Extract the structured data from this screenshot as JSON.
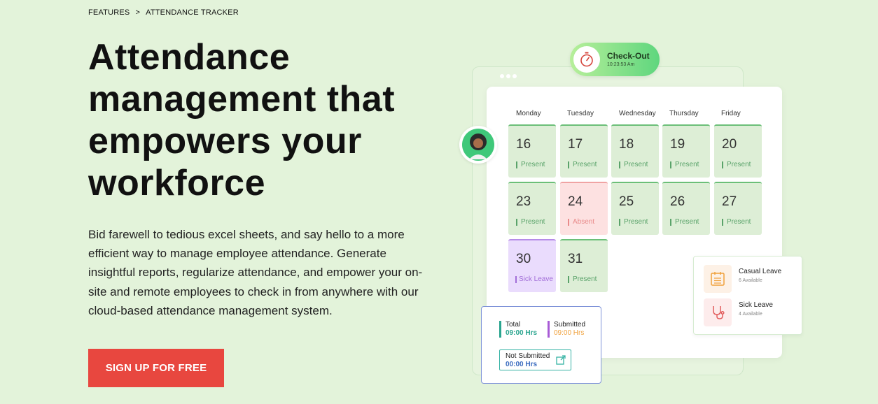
{
  "breadcrumb": {
    "items": [
      "FEATURES",
      "ATTENDANCE TRACKER"
    ],
    "separator": ">"
  },
  "hero": {
    "title_lines": [
      "Attendance",
      "management that",
      "empowers your",
      "workforce"
    ],
    "description": "Bid farewell to tedious excel sheets, and say hello to a more efficient way to manage employee attendance. Generate insightful reports, regularize attendance, and empower your on-site and remote employees to check in from anywhere with our cloud-based attendance management system.",
    "cta_label": "SIGN UP FOR FREE"
  },
  "checkout": {
    "label": "Check-Out",
    "time": "10:23:53 Am",
    "icon": "stopwatch-icon"
  },
  "calendar": {
    "days": [
      "Monday",
      "Tuesday",
      "Wednesday",
      "Thursday",
      "Friday"
    ],
    "weeks": [
      [
        {
          "date": "16",
          "status": "Present"
        },
        {
          "date": "17",
          "status": "Present"
        },
        {
          "date": "18",
          "status": "Present"
        },
        {
          "date": "19",
          "status": "Present"
        },
        {
          "date": "20",
          "status": "Present"
        }
      ],
      [
        {
          "date": "23",
          "status": "Present"
        },
        {
          "date": "24",
          "status": "Absent"
        },
        {
          "date": "25",
          "status": "Present"
        },
        {
          "date": "26",
          "status": "Present"
        },
        {
          "date": "27",
          "status": "Present"
        }
      ],
      [
        {
          "date": "30",
          "status": "Sick Leave"
        },
        {
          "date": "31",
          "status": "Present"
        }
      ]
    ]
  },
  "leave_balance": [
    {
      "type": "Casual Leave",
      "available": "6 Available",
      "icon": "calendar-list-icon"
    },
    {
      "type": "Sick Leave",
      "available": "4 Available",
      "icon": "stethoscope-icon"
    }
  ],
  "hours": {
    "total_label": "Total",
    "total_value": "09:00 Hrs",
    "submitted_label": "Submitted",
    "submitted_value": "09:00 Hrs",
    "not_submitted_label": "Not Submitted",
    "not_submitted_value": "00:00 Hrs"
  },
  "colors": {
    "background": "#e3f3da",
    "cta": "#e8473f",
    "present": "#5aa36a",
    "absent": "#e98b8b",
    "sick_leave": "#a26ed8",
    "total_bar": "#2aa58f",
    "submitted_bar": "#a85bd6",
    "submitted_value": "#f0a13c",
    "not_submitted_value": "#3a6bbf"
  }
}
